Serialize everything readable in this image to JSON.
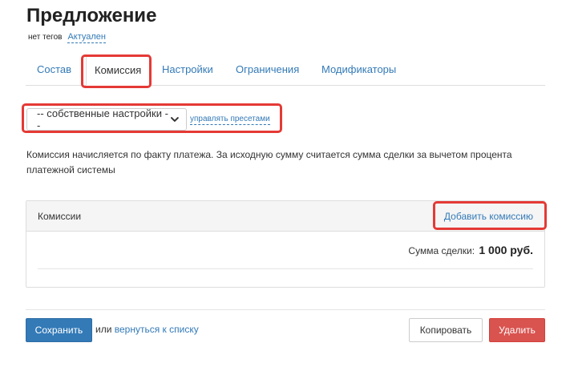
{
  "page": {
    "title": "Предложение",
    "tags_text": "нет тегов",
    "status_text": "Актуален"
  },
  "tabs": [
    {
      "label": "Состав",
      "active": false
    },
    {
      "label": "Комиссия",
      "active": true
    },
    {
      "label": "Настройки",
      "active": false
    },
    {
      "label": "Ограничения",
      "active": false
    },
    {
      "label": "Модификаторы",
      "active": false
    }
  ],
  "presets": {
    "selected": "-- собственные настройки --",
    "manage_link": "управлять пресетами"
  },
  "description": "Комиссия начисляется по факту платежа. За исходную сумму считается сумма сделки за вычетом процента платежной системы",
  "commissions_panel": {
    "title": "Комиссии",
    "add_link": "Добавить комиссию",
    "sum_label": "Сумма сделки:",
    "sum_value": "1 000 руб."
  },
  "footer": {
    "save_label": "Сохранить",
    "or_text": "или",
    "back_link": "вернуться к списку",
    "copy_label": "Копировать",
    "delete_label": "Удалить"
  },
  "colors": {
    "link": "#337ab7",
    "primary": "#337ab7",
    "danger": "#d9534f",
    "highlight": "#e53935"
  }
}
